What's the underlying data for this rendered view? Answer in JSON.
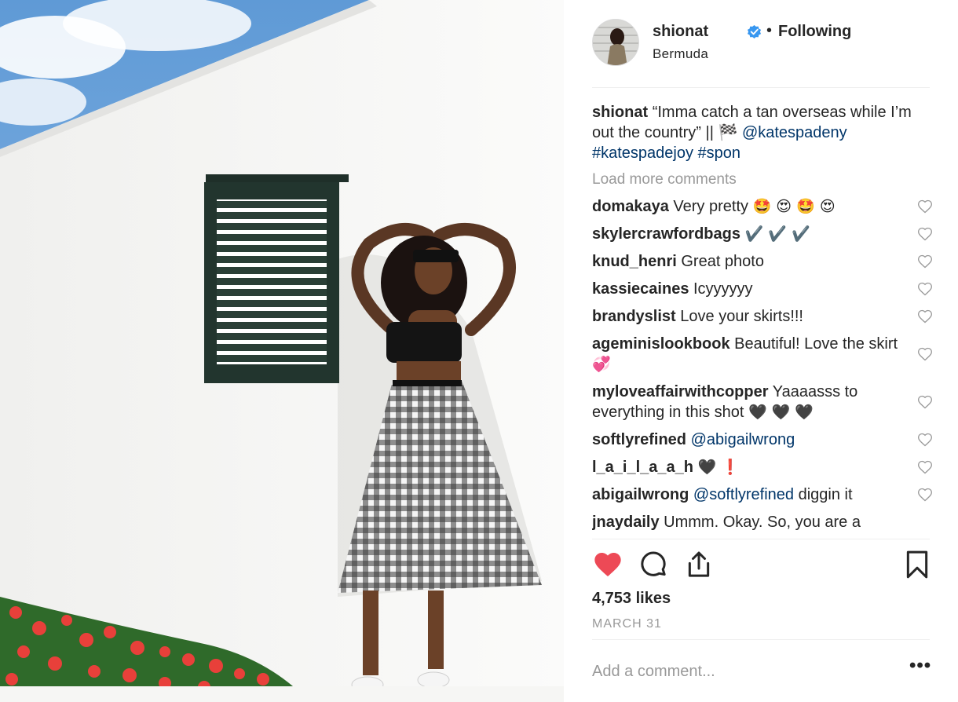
{
  "photo": {
    "alt": ""
  },
  "header": {
    "username": "shionat",
    "separator": "•",
    "follow_status": "Following",
    "location": "Bermuda"
  },
  "caption": {
    "username": "shionat",
    "text": "“Imma catch a tan overseas while I’m out the country” || 🏁",
    "mention": "@katespadeny",
    "hashtag1": "#katespadejoy",
    "hashtag2": "#spon"
  },
  "load_more": "Load more comments",
  "comments": [
    {
      "user": "domakaya",
      "text": "Very pretty",
      "emoji": "🤩 😍 🤩 😍"
    },
    {
      "user": "skylercrawfordbags",
      "text": "",
      "emoji": "✔️ ✔️ ✔️"
    },
    {
      "user": "knud_henri",
      "text": "Great photo",
      "emoji": ""
    },
    {
      "user": "kassiecaines",
      "text": "Icyyyyyy",
      "emoji": ""
    },
    {
      "user": "brandyslist",
      "text": "Love your skirts!!!",
      "emoji": ""
    },
    {
      "user": "ageminislookbook",
      "text": "Beautiful! Love the skirt",
      "emoji": "💞"
    },
    {
      "user": "myloveaffairwithcopper",
      "text": "Yaaaasss to everything in this shot",
      "emoji": "🖤 🖤 🖤"
    },
    {
      "user": "softlyrefined",
      "mention": "@abigailwrong",
      "text": "",
      "emoji": ""
    },
    {
      "user": "l_a_i_l_a_a_h",
      "text": "",
      "emoji": "🖤 ❗"
    },
    {
      "user": "abigailwrong",
      "mention": "@softlyrefined",
      "text": "diggin it",
      "emoji": ""
    },
    {
      "user": "jnaydaily",
      "text": "Ummm. Okay. So, you are a",
      "emoji": ""
    }
  ],
  "likes": "4,753 likes",
  "date": "MARCH 31",
  "comment_input": {
    "placeholder": "Add a comment..."
  },
  "more": "•••",
  "colors": {
    "liked_heart": "#ed4956",
    "link": "#003569",
    "verified": "#3897f0",
    "muted": "#999999"
  },
  "icons": [
    "verified-badge-icon",
    "heart-filled-icon",
    "comment-icon",
    "share-icon",
    "bookmark-icon",
    "heart-outline-icon",
    "more-options-icon"
  ]
}
